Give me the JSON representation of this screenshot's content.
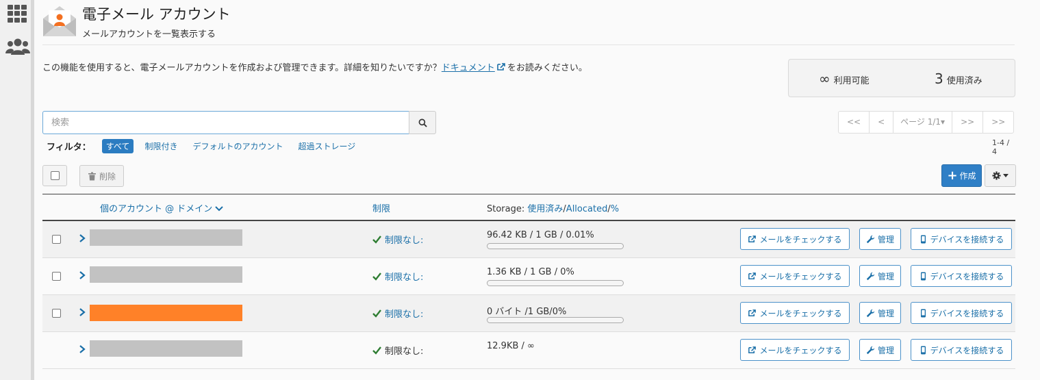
{
  "header": {
    "title": "電子メール アカウント",
    "subtitle": "メールアカウントを一覧表示する"
  },
  "description": {
    "before": "この機能を使用すると、電子メールアカウントを作成および管理できます。詳細を知りたいですか？",
    "link": "ドキュメント",
    "after": "をお読みください。"
  },
  "stats": {
    "available_value": "∞",
    "available_label": "利用可能",
    "used_value": "3",
    "used_label": "使用済み"
  },
  "search": {
    "placeholder": "検索"
  },
  "pager": {
    "first": "<<",
    "prev": "<",
    "page": "ページ 1/1▾",
    "next": ">>",
    "last": ">>",
    "count": "1-4 / 4"
  },
  "filter": {
    "label": "フィルタ：",
    "items": [
      "すべて",
      "制限付き",
      "デフォルトのアカウント",
      "超過ストレージ"
    ]
  },
  "toolbar": {
    "delete_label": "削除",
    "create_label": "作成"
  },
  "table": {
    "col_account": "個のアカウント @ ドメイン",
    "col_limit": "制限",
    "col_storage_prefix": "Storage: ",
    "col_storage_used": "使用済み",
    "col_storage_sep1": "/",
    "col_storage_alloc": "Allocated",
    "col_storage_sep2": "/",
    "col_storage_pct": "%",
    "rows": [
      {
        "limit": "制限なし:",
        "usage": "96.42 KB / 1 GB / 0.01%",
        "usage_fraction": 0.0001,
        "has_checkbox": true,
        "redacted_color": "#c2c2c2"
      },
      {
        "limit": "制限なし:",
        "usage": "1.36 KB / 1 GB / 0%",
        "usage_fraction": 0,
        "has_checkbox": true,
        "redacted_color": "#c2c2c2"
      },
      {
        "limit": "制限なし:",
        "usage": "0 バイト /1 GB/0%",
        "usage_fraction": 0,
        "has_checkbox": true,
        "redacted_color": "#ff8128"
      },
      {
        "limit": "制限なし:",
        "usage": "12.9KB / ∞",
        "usage_fraction": null,
        "has_checkbox": false,
        "redacted_color": "#c2c2c2"
      }
    ],
    "btn_check": "メールをチェックする",
    "btn_manage": "管理",
    "btn_device": "デバイスを接続する"
  },
  "colors": {
    "link": "#1a6fa8",
    "primary": "#2f7fc6",
    "check_green": "#2e7d32",
    "accent_orange": "#ff8128"
  }
}
